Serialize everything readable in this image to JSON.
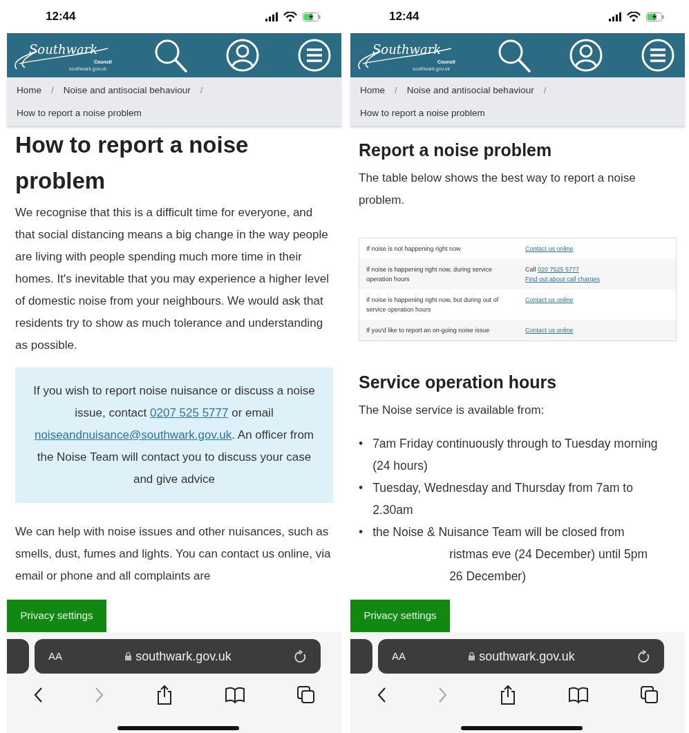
{
  "phones": [
    {
      "status_time": "12:44",
      "logo": {
        "name": "Southwark",
        "sub": "Council",
        "url": "southwark.gov.uk"
      },
      "breadcrumb": [
        {
          "label": "Home"
        },
        {
          "label": "Noise and antisocial behaviour"
        },
        {
          "label": "How to report a noise problem"
        }
      ],
      "separator": "/",
      "blocks": [
        {
          "kind": "title",
          "text": "How to report a noise problem"
        },
        {
          "kind": "paragraph",
          "text": "We recognise that this is a difficult time for everyone, and that social distancing means a big change in the way people are living with people spending much more time in their homes. It's inevitable that you may experience a higher level of domestic noise from your neighbours. We would ask that residents try to show as much tolerance and understanding as possible."
        },
        {
          "kind": "callout",
          "segments": [
            {
              "kind": "text",
              "text": "If you wish to report noise nuisance or discuss a noise issue, contact "
            },
            {
              "kind": "link",
              "text": "0207 525 5777"
            },
            {
              "kind": "text",
              "text": " or email "
            },
            {
              "kind": "link",
              "text": "noiseandnuisance@southwark.gov.uk"
            },
            {
              "kind": "text",
              "text": ". An officer from the Noise Team will contact you to discuss your case and give advice"
            }
          ]
        },
        {
          "kind": "paragraph",
          "text": "We can help with noise issues and other nuisances, such as smells, dust, fumes and lights. You can contact us online, via email or phone and all complaints are"
        }
      ],
      "privacy_button": "Privacy settings",
      "address": {
        "text_size": "AA",
        "domain": "southwark.gov.uk"
      },
      "forward_disabled": true
    },
    {
      "status_time": "12:44",
      "logo": {
        "name": "Southwark",
        "sub": "Council",
        "url": "southwark.gov.uk"
      },
      "breadcrumb": [
        {
          "label": "Home"
        },
        {
          "label": "Noise and antisocial behaviour"
        },
        {
          "label": "How to report a noise problem"
        }
      ],
      "separator": "/",
      "blocks": [
        {
          "kind": "heading",
          "text": "Report a noise problem"
        },
        {
          "kind": "paragraph",
          "text": "The table below shows the best way to report a noise problem."
        },
        {
          "kind": "table",
          "rows": [
            {
              "condition": "If noise is not happening right now",
              "action": [
                {
                  "kind": "link",
                  "text": "Contact us online"
                }
              ]
            },
            {
              "condition": "If noise is happening right now, during service operation hours",
              "action": [
                {
                  "kind": "text",
                  "text": "Call "
                },
                {
                  "kind": "link",
                  "text": "020 7525 5777"
                },
                {
                  "kind": "break"
                },
                {
                  "kind": "link",
                  "text": "Find out about call charges"
                }
              ]
            },
            {
              "condition": "If noise is happening right now, but during out of service operation hours",
              "action": [
                {
                  "kind": "link",
                  "text": "Contact us online"
                }
              ]
            },
            {
              "condition": "If you'd like to report an on-going noise issue",
              "action": [
                {
                  "kind": "link",
                  "text": "Contact us online"
                }
              ]
            }
          ]
        },
        {
          "kind": "heading",
          "text": "Service operation hours"
        },
        {
          "kind": "paragraph",
          "text": "The Noise service is available from:"
        },
        {
          "kind": "list",
          "items": [
            {
              "marker": "•",
              "text": "7am Friday continuously through to Tuesday morning (24 hours)"
            },
            {
              "marker": "•",
              "text": "Tuesday, Wednesday and Thursday from 7am to 2.30am"
            },
            {
              "marker": "•",
              "text": "the Noise & Nuisance Team will be closed from",
              "covered": [
                "ristmas eve (24 December) until 5pm",
                "26 December)"
              ]
            }
          ]
        }
      ],
      "privacy_button": "Privacy settings",
      "address": {
        "text_size": "AA",
        "domain": "southwark.gov.uk"
      },
      "forward_disabled": true
    }
  ]
}
